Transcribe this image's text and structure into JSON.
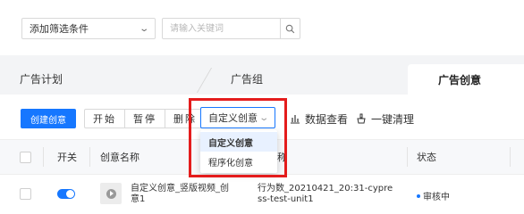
{
  "filter": {
    "condition_label": "添加筛选条件",
    "search_placeholder": "请输入关键词"
  },
  "tabs": [
    {
      "label": "广告计划"
    },
    {
      "label": "广告组"
    },
    {
      "label": "广告创意",
      "active": true
    }
  ],
  "toolbar": {
    "create_label": "创建创意",
    "start_label": "开始",
    "pause_label": "暂停",
    "delete_label": "删除",
    "type_select_value": "自定义创意",
    "data_view_label": "数据查看",
    "clear_label": "一键清理"
  },
  "dropdown": {
    "options": [
      {
        "label": "自定义创意",
        "selected": true
      },
      {
        "label": "程序化创意",
        "selected": false
      }
    ]
  },
  "table": {
    "headers": {
      "toggle": "开关",
      "name": "创意名称",
      "plan_partial": "称",
      "status": "状态"
    },
    "rows": [
      {
        "toggle_on": true,
        "name_line1": "自定义创意_竖版视频_创",
        "name_line2": "意1",
        "plan_line1": "行为数_20210421_20:31-cypre",
        "plan_line2": "ss-test-unit1",
        "status": "审核中"
      }
    ]
  },
  "colors": {
    "primary": "#1677ff",
    "highlight": "#e41c1c",
    "tab_bg": "#f3f4f6"
  },
  "icons": {
    "search": "search-icon",
    "chevron": "chevron-down-icon",
    "chart": "bar-chart-icon",
    "broom": "clean-icon",
    "play": "play-icon"
  }
}
